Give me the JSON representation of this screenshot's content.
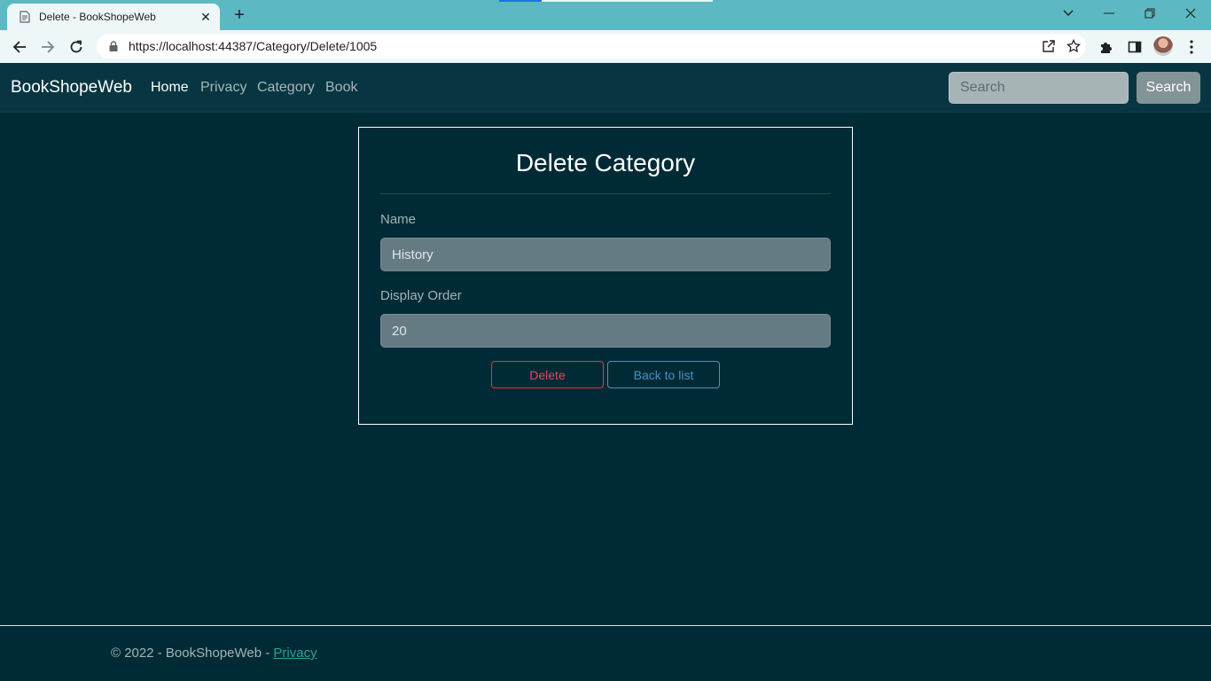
{
  "browser": {
    "tab_title": "Delete - BookShopeWeb",
    "url": "https://localhost:44387/Category/Delete/1005"
  },
  "navbar": {
    "brand": "BookShopeWeb",
    "links": [
      {
        "label": "Home"
      },
      {
        "label": "Privacy"
      },
      {
        "label": "Category"
      },
      {
        "label": "Book"
      }
    ],
    "search_placeholder": "Search",
    "search_button": "Search"
  },
  "form": {
    "title": "Delete Category",
    "name_label": "Name",
    "name_value": "History",
    "order_label": "Display Order",
    "order_value": "20",
    "delete_button": "Delete",
    "back_button": "Back to list"
  },
  "footer": {
    "text": "© 2022 - BookShopeWeb - ",
    "link": "Privacy"
  },
  "colors": {
    "page_bg": "#002b36",
    "navbar_bg": "#073642",
    "danger": "#dc3545",
    "primary_outline": "#4a90c8",
    "footer_link": "#2aa198"
  }
}
